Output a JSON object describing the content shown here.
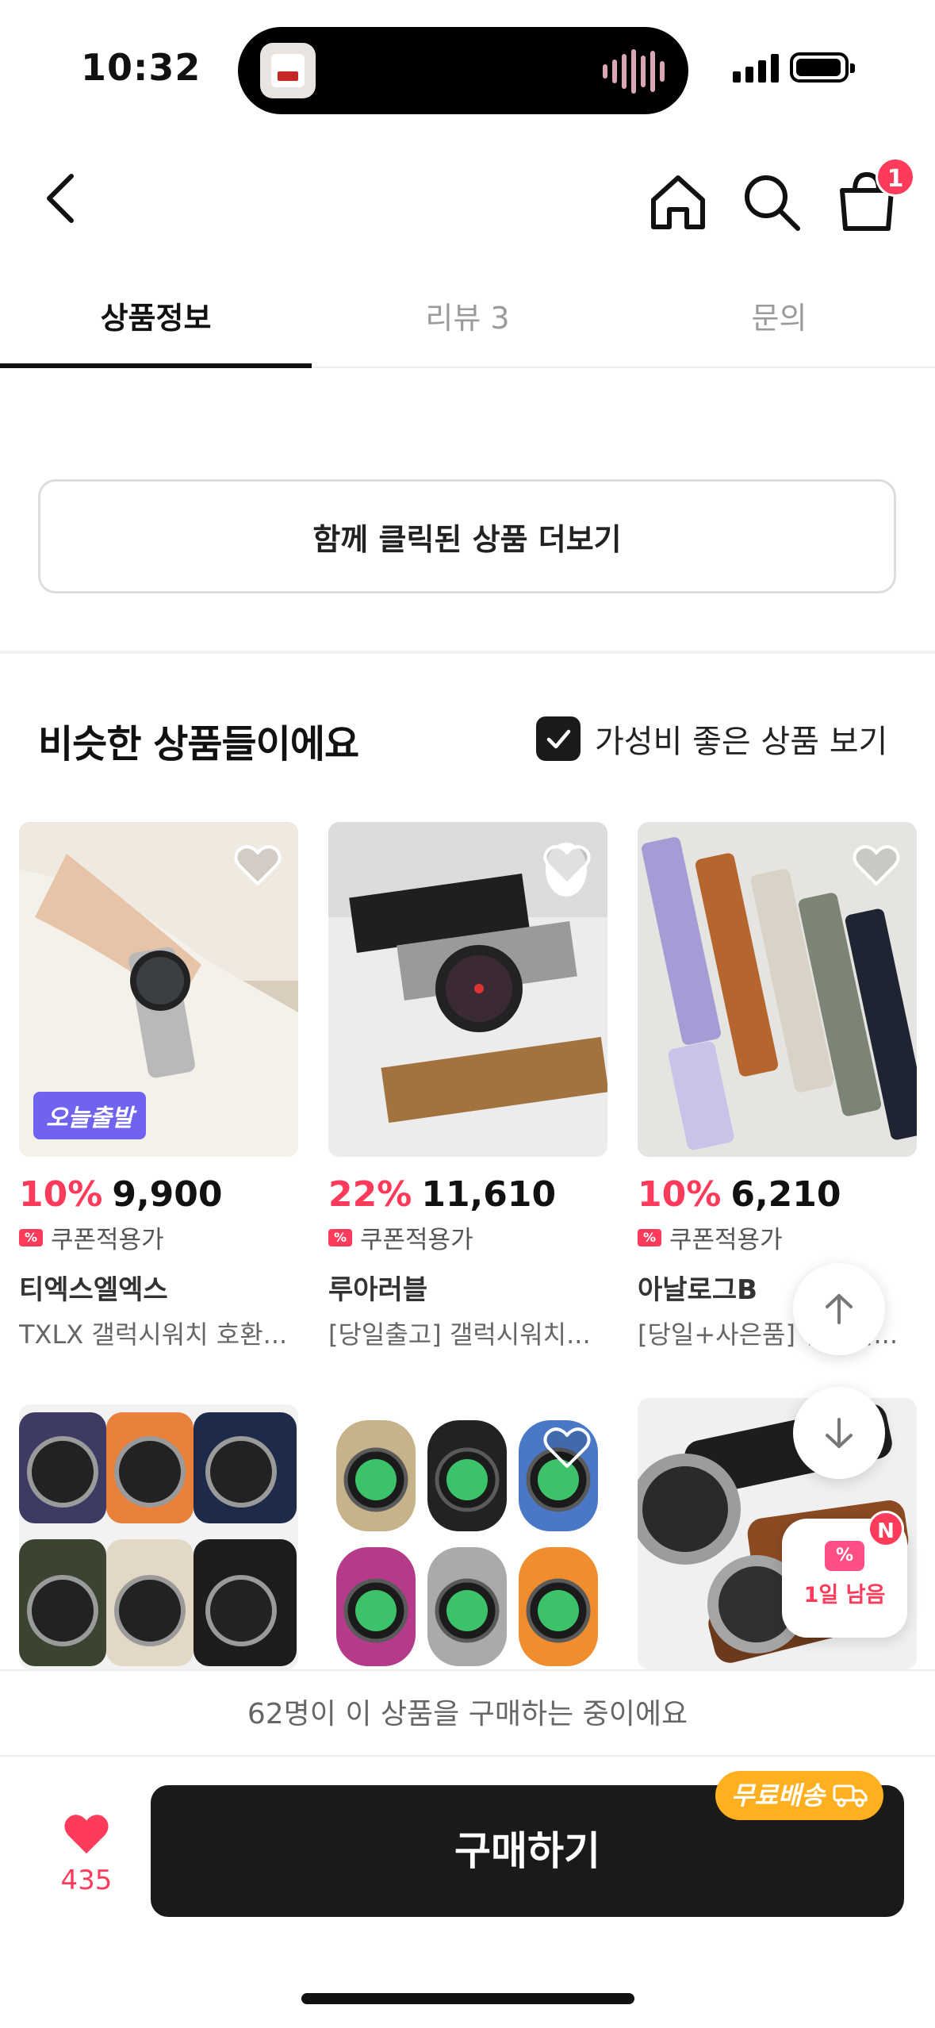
{
  "status": {
    "time": "10:32"
  },
  "header": {
    "cart_count": "1"
  },
  "tabs": [
    {
      "label": "상품정보",
      "active": true
    },
    {
      "label": "리뷰 3",
      "active": false
    },
    {
      "label": "문의",
      "active": false
    }
  ],
  "more_button": {
    "label": "함께 클릭된 상품 더보기"
  },
  "similar": {
    "title": "비슷한 상품들이에요",
    "value_toggle_label": "가성비 좋은 상품 보기",
    "value_toggle_checked": true
  },
  "products": [
    {
      "discount": "10%",
      "price": "9,900",
      "coupon_label": "쿠폰적용가",
      "brand": "티엑스엘엑스",
      "name": "TXLX 갤럭시워치 호환...",
      "badge": "오늘출발"
    },
    {
      "discount": "22%",
      "price": "11,610",
      "coupon_label": "쿠폰적용가",
      "brand": "루아러블",
      "name": "[당일출고] 갤럭시워치..."
    },
    {
      "discount": "10%",
      "price": "6,210",
      "coupon_label": "쿠폰적용가",
      "brand": "아날로그B",
      "name": "[당일+사은품] 갤럭시..."
    }
  ],
  "coupon_float": {
    "label": "1일 남음",
    "badge": "N"
  },
  "buyers_notice": "62명이 이 상품을 구매하는 중이에요",
  "bottom": {
    "like_count": "435",
    "buy_label": "구매하기",
    "free_shipping": "무료배송"
  },
  "colors": {
    "accent": "#ff3b5c",
    "buy_button": "#1a1a1a",
    "free_shipping": "#ffb020",
    "same_day_badge": "#6f63f0"
  }
}
